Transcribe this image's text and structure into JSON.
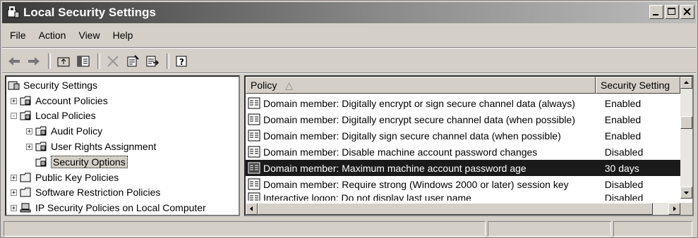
{
  "window": {
    "title": "Local Security Settings"
  },
  "menu": [
    "File",
    "Action",
    "View",
    "Help"
  ],
  "toolbar": [
    "back-arrow-icon",
    "forward-arrow-icon",
    "up-folder-icon",
    "show-hide-tree-icon",
    "delete-icon",
    "properties-icon",
    "export-list-icon",
    "help-icon"
  ],
  "tree": {
    "root": "Security Settings",
    "items": [
      {
        "label": "Account Policies",
        "state": "+"
      },
      {
        "label": "Local Policies",
        "state": "-"
      },
      {
        "label": "Audit Policy",
        "state": "+"
      },
      {
        "label": "User Rights Assignment",
        "state": "+"
      },
      {
        "label": "Security Options",
        "state": ""
      },
      {
        "label": "Public Key Policies",
        "state": "+"
      },
      {
        "label": "Software Restriction Policies",
        "state": "+"
      },
      {
        "label": "IP Security Policies on Local Computer",
        "state": "+"
      }
    ]
  },
  "list": {
    "columns": [
      "Policy",
      "Security Setting"
    ],
    "rows": [
      {
        "policy": "Domain member: Digitally encrypt or sign secure channel data (always)",
        "setting": "Enabled"
      },
      {
        "policy": "Domain member: Digitally encrypt secure channel data (when possible)",
        "setting": "Enabled"
      },
      {
        "policy": "Domain member: Digitally sign secure channel data (when possible)",
        "setting": "Enabled"
      },
      {
        "policy": "Domain member: Disable machine account password changes",
        "setting": "Disabled"
      },
      {
        "policy": "Domain member: Maximum machine account password age",
        "setting": "30 days"
      },
      {
        "policy": "Domain member: Require strong (Windows 2000 or later) session key",
        "setting": "Disabled"
      },
      {
        "policy": "Interactive logon: Do not display last user name",
        "setting": "Disabled"
      }
    ]
  }
}
